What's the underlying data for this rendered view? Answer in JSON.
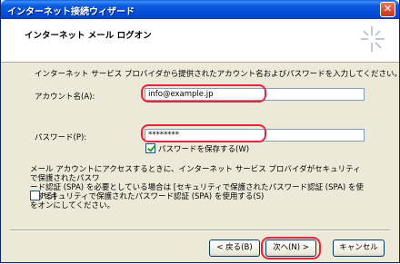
{
  "window": {
    "title": "インターネット接続ウィザード",
    "close_glyph": "✕"
  },
  "header": {
    "title": "インターネット メール ログオン",
    "icon": "wizard-sparkle-icon"
  },
  "intro_text": "インターネット サービス プロバイダから提供されたアカウント名およびパスワードを入力してください。",
  "account": {
    "label": "アカウント名",
    "accel": "(A):",
    "value": "info@example.jp"
  },
  "password": {
    "label": "パスワード",
    "accel": "(P):",
    "value": "********"
  },
  "save_password": {
    "label": "パスワードを保存する",
    "accel": "(W)",
    "checked": true
  },
  "spa_note_lines": [
    "メール アカウントにアクセスするときに、インターネット サービス プロバイダがセキュリティで保護されたパスワ",
    "ード認証 (SPA) を必要としている場合は [セキュリティで保護されたパスワード認証 (SPA) を使用する]",
    "をオンにしてください。"
  ],
  "spa_checkbox": {
    "label": "セキュリティで保護されたパスワード認証 (SPA) を使用する",
    "accel": "(S)",
    "checked": false
  },
  "buttons": {
    "back": "< 戻る(B)",
    "next": "次へ(N) >",
    "cancel": "キャンセル"
  },
  "colors": {
    "highlight": "#e8243c",
    "titlebar": "#0a5be0"
  }
}
